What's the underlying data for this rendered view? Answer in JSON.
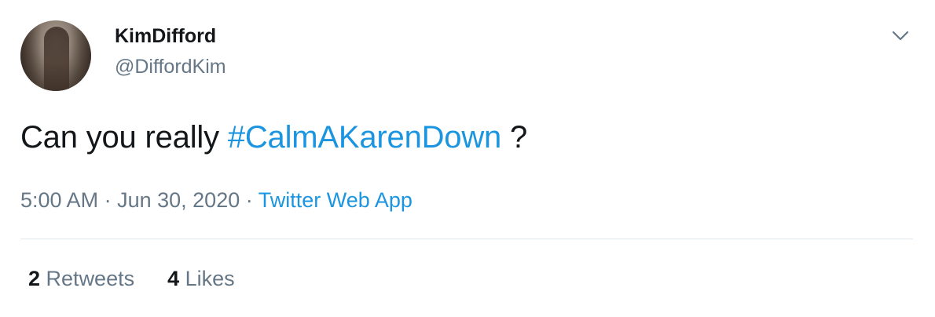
{
  "user": {
    "display_name": "KimDifford",
    "handle": "@DiffordKim",
    "avatar": "avatar-photo"
  },
  "menu": {
    "icon": "chevron-down-icon"
  },
  "tweet": {
    "text_before": "Can you really ",
    "hashtag": "#CalmAKarenDown",
    "text_after": " ?"
  },
  "meta": {
    "time": "5:00 AM",
    "date": "Jun 30, 2020",
    "separator": "·",
    "source": "Twitter Web App"
  },
  "stats": {
    "retweets_count": "2",
    "retweets_label": "Retweets",
    "likes_count": "4",
    "likes_label": "Likes"
  },
  "colors": {
    "link": "#1b95e0",
    "secondary_text": "#657786",
    "primary_text": "#14171a",
    "divider": "#e1e8ed"
  }
}
